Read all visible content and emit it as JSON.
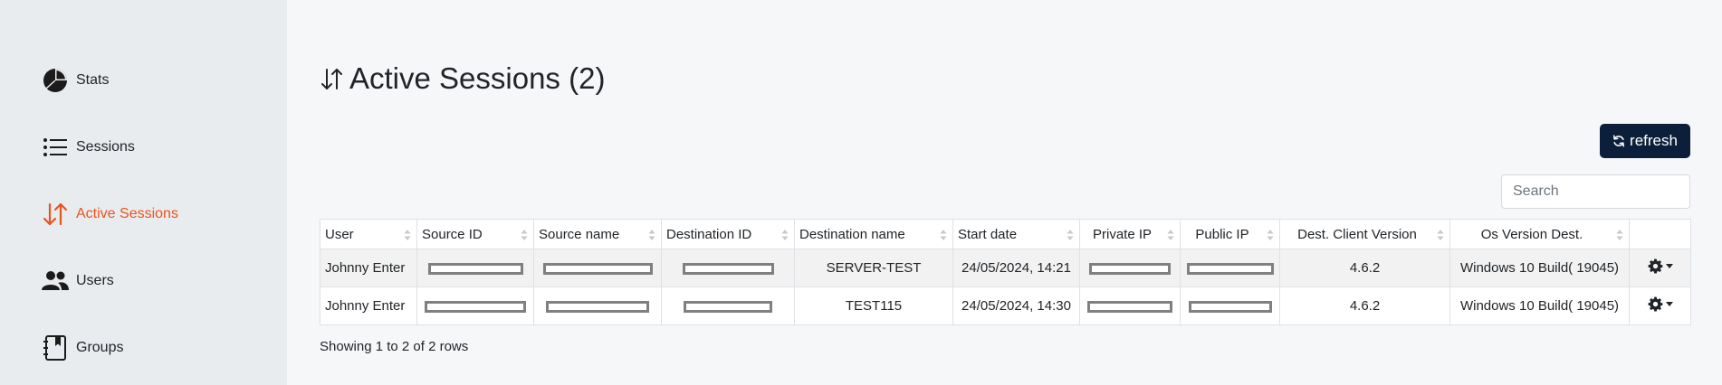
{
  "sidebar": {
    "items": [
      {
        "label": "Stats",
        "icon": "pie-chart-icon",
        "active": false
      },
      {
        "label": "Sessions",
        "icon": "list-icon",
        "active": false
      },
      {
        "label": "Active Sessions",
        "icon": "sort-arrows-icon",
        "active": true
      },
      {
        "label": "Users",
        "icon": "users-icon",
        "active": false
      },
      {
        "label": "Groups",
        "icon": "address-book-icon",
        "active": false
      }
    ]
  },
  "page": {
    "title": "Active Sessions (2)",
    "refresh_label": "refresh",
    "search_placeholder": "Search",
    "rows_info": "Showing 1 to 2 of 2 rows"
  },
  "table": {
    "columns": [
      "User",
      "Source ID",
      "Source name",
      "Destination ID",
      "Destination name",
      "Start date",
      "Private IP",
      "Public IP",
      "Dest. Client Version",
      "Os Version Dest.",
      ""
    ],
    "rows": [
      {
        "user": "Johnny Enter",
        "destination_name": "SERVER-TEST",
        "start_date": "24/05/2024, 14:21",
        "client_version": "4.6.2",
        "os_version": "Windows 10 Build( 19045)"
      },
      {
        "user": "Johnny Enter",
        "destination_name": "TEST115",
        "start_date": "24/05/2024, 14:30",
        "client_version": "4.6.2",
        "os_version": "Windows 10 Build( 19045)"
      }
    ]
  },
  "colors": {
    "accent": "#e8541e",
    "button_bg": "#0c1f3a",
    "sidebar_bg": "#e9ecef",
    "redaction": "#808080"
  }
}
